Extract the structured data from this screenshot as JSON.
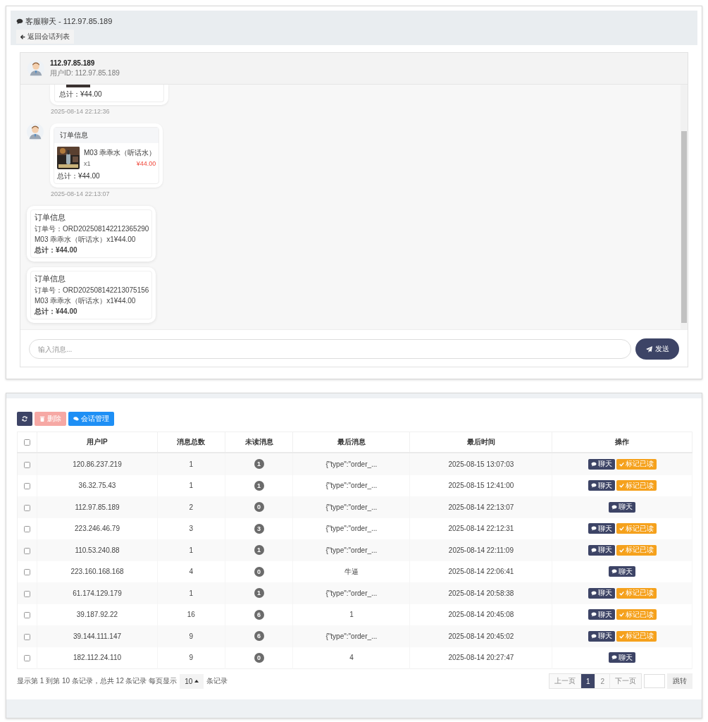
{
  "chat_panel": {
    "title": "客服聊天 - 112.97.85.189",
    "back_button": "返回会话列表",
    "user": {
      "name": "112.97.85.189",
      "id": "用户ID: 112.97.85.189"
    },
    "messages": [
      {
        "kind": "product_partial",
        "total": "总计：¥44.00",
        "time": "2025-08-14 22:12:36"
      },
      {
        "kind": "product_card",
        "header": "订单信息",
        "product": "M03 乖乖水（听话水）",
        "qty": "x1",
        "price": "¥44.00",
        "total": "总计：¥44.00",
        "time": "2025-08-14 22:13:07"
      },
      {
        "kind": "order_text",
        "title": "订单信息",
        "order_no": "订单号：ORD202508142212365290",
        "item": "M03 乖乖水（听话水）x1¥44.00",
        "total": "**总计：¥44.00**"
      },
      {
        "kind": "order_text",
        "title": "订单信息",
        "order_no": "订单号：ORD202508142213075156",
        "item": "M03 乖乖水（听话水）x1¥44.00",
        "total": "**总计：¥44.00**"
      }
    ],
    "input": {
      "placeholder": "输入消息..."
    },
    "send_button": "发送"
  },
  "sessions": {
    "toolbar": [
      {
        "kind": "refresh",
        "disabled": false
      },
      {
        "kind": "delete",
        "label": "删除",
        "disabled": true
      },
      {
        "kind": "manage",
        "label": "会话管理",
        "disabled": false
      }
    ],
    "table": {
      "select_all": {
        "checked": false
      },
      "columns": [
        "用户IP",
        "消息总数",
        "未读消息",
        "最后消息",
        "最后时间",
        "操作"
      ],
      "rows": [
        {
          "checked": false,
          "ip": "120.86.237.219",
          "total": "1",
          "unread": "1",
          "last": "{\"type\":\"order_...",
          "time": "2025-08-15 13:07:03",
          "actions": [
            {
              "kind": "chat",
              "label": "聊天"
            },
            {
              "kind": "mark_read",
              "label": "标记已读"
            }
          ]
        },
        {
          "checked": false,
          "ip": "36.32.75.43",
          "total": "1",
          "unread": "1",
          "last": "{\"type\":\"order_...",
          "time": "2025-08-15 12:41:00",
          "actions": [
            {
              "kind": "chat",
              "label": "聊天"
            },
            {
              "kind": "mark_read",
              "label": "标记已读"
            }
          ]
        },
        {
          "checked": false,
          "ip": "112.97.85.189",
          "total": "2",
          "unread": "0",
          "last": "{\"type\":\"order_...",
          "time": "2025-08-14 22:13:07",
          "actions": [
            {
              "kind": "chat",
              "label": "聊天"
            }
          ]
        },
        {
          "checked": false,
          "ip": "223.246.46.79",
          "total": "3",
          "unread": "3",
          "last": "{\"type\":\"order_...",
          "time": "2025-08-14 22:12:31",
          "actions": [
            {
              "kind": "chat",
              "label": "聊天"
            },
            {
              "kind": "mark_read",
              "label": "标记已读"
            }
          ]
        },
        {
          "checked": false,
          "ip": "110.53.240.88",
          "total": "1",
          "unread": "1",
          "last": "{\"type\":\"order_...",
          "time": "2025-08-14 22:11:09",
          "actions": [
            {
              "kind": "chat",
              "label": "聊天"
            },
            {
              "kind": "mark_read",
              "label": "标记已读"
            }
          ]
        },
        {
          "checked": false,
          "ip": "223.160.168.168",
          "total": "4",
          "unread": "0",
          "last": "牛逼",
          "time": "2025-08-14 22:06:41",
          "actions": [
            {
              "kind": "chat",
              "label": "聊天"
            }
          ]
        },
        {
          "checked": false,
          "ip": "61.174.129.179",
          "total": "1",
          "unread": "1",
          "last": "{\"type\":\"order_...",
          "time": "2025-08-14 20:58:38",
          "actions": [
            {
              "kind": "chat",
              "label": "聊天"
            },
            {
              "kind": "mark_read",
              "label": "标记已读"
            }
          ]
        },
        {
          "checked": false,
          "ip": "39.187.92.22",
          "total": "16",
          "unread": "6",
          "last": "1",
          "time": "2025-08-14 20:45:08",
          "actions": [
            {
              "kind": "chat",
              "label": "聊天"
            },
            {
              "kind": "mark_read",
              "label": "标记已读"
            }
          ]
        },
        {
          "checked": false,
          "ip": "39.144.111.147",
          "total": "9",
          "unread": "6",
          "last": "{\"type\":\"order_...",
          "time": "2025-08-14 20:45:02",
          "actions": [
            {
              "kind": "chat",
              "label": "聊天"
            },
            {
              "kind": "mark_read",
              "label": "标记已读"
            }
          ]
        },
        {
          "checked": false,
          "ip": "182.112.24.110",
          "total": "9",
          "unread": "0",
          "last": "4",
          "time": "2025-08-14 20:27:47",
          "actions": [
            {
              "kind": "chat",
              "label": "聊天"
            }
          ]
        }
      ]
    },
    "footer": {
      "info": "显示第 1 到第 10 条记录，总共 12 条记录 每页显示",
      "page_size": "10",
      "page_size_suffix": "条记录"
    },
    "pagination": {
      "pages": [
        {
          "label": "上一页",
          "selected": false
        },
        {
          "label": "1",
          "selected": true
        },
        {
          "label": "2",
          "selected": false
        },
        {
          "label": "下一页",
          "selected": false
        }
      ],
      "jump_button": "跳转"
    }
  }
}
